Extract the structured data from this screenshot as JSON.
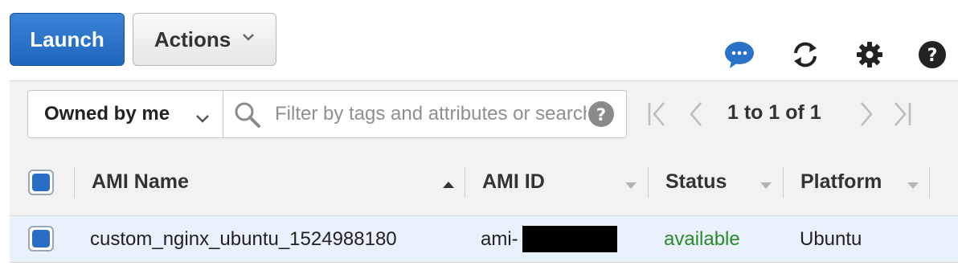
{
  "toolbar": {
    "launch_label": "Launch",
    "actions_label": "Actions",
    "icons": [
      "chat-icon",
      "refresh-icon",
      "gear-icon",
      "help-icon"
    ]
  },
  "filter": {
    "owner_select": "Owned by me",
    "search_placeholder": "Filter by tags and attributes or search by keyword",
    "pagination_text": "1 to 1 of 1"
  },
  "table": {
    "columns": [
      "AMI Name",
      "AMI ID",
      "Status",
      "Platform"
    ],
    "rows": [
      {
        "ami_name": "custom_nginx_ubuntu_1524988180",
        "ami_id_prefix": "ami-",
        "status": "available",
        "platform": "Ubuntu",
        "selected": true
      }
    ]
  },
  "colors": {
    "launch_blue": "#1f66bd",
    "status_available": "#2a8a2a",
    "selected_row": "#e8f1fc"
  }
}
